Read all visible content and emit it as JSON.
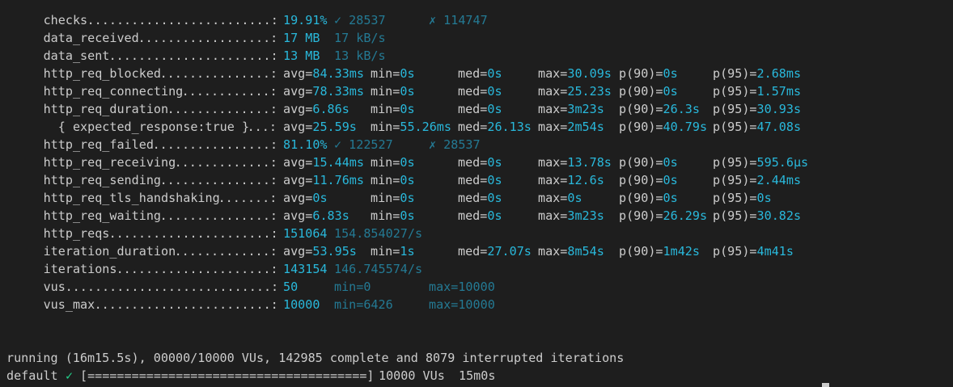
{
  "metrics": [
    {
      "name": "checks",
      "dots": ".........................:",
      "values": [
        {
          "text": "19.91%",
          "style": "hl"
        },
        {
          "text": "✓ 28537",
          "style": "dim"
        },
        {
          "text": "✗ 114747",
          "style": "dim"
        }
      ]
    },
    {
      "name": "data_received",
      "dots": "..................:",
      "values": [
        {
          "text": "17 MB",
          "style": "hl"
        },
        {
          "text": "17 kB/s",
          "style": "dim"
        }
      ]
    },
    {
      "name": "data_sent",
      "dots": "......................:",
      "values": [
        {
          "text": "13 MB",
          "style": "hl"
        },
        {
          "text": "13 kB/s",
          "style": "dim"
        }
      ]
    },
    {
      "name": "http_req_blocked",
      "dots": "...............:",
      "stats": {
        "avg": "84.33ms",
        "min": "0s",
        "med": "0s",
        "max": "30.09s",
        "p90": "0s",
        "p95": "2.68ms"
      }
    },
    {
      "name": "http_req_connecting",
      "dots": "............:",
      "stats": {
        "avg": "78.33ms",
        "min": "0s",
        "med": "0s",
        "max": "25.23s",
        "p90": "0s",
        "p95": "1.57ms"
      }
    },
    {
      "name": "http_req_duration",
      "dots": "..............:",
      "stats": {
        "avg": "6.86s",
        "min": "0s",
        "med": "0s",
        "max": "3m23s",
        "p90": "26.3s",
        "p95": "30.93s"
      }
    },
    {
      "name": "  { expected_response:true }",
      "dots": "...:",
      "stats": {
        "avg": "25.59s",
        "min": "55.26ms",
        "med": "26.13s",
        "max": "2m54s",
        "p90": "40.79s",
        "p95": "47.08s"
      }
    },
    {
      "name": "http_req_failed",
      "dots": "................:",
      "values": [
        {
          "text": "81.10%",
          "style": "hl"
        },
        {
          "text": "✓ 122527",
          "style": "dim"
        },
        {
          "text": "✗ 28537",
          "style": "dim"
        }
      ]
    },
    {
      "name": "http_req_receiving",
      "dots": ".............:",
      "stats": {
        "avg": "15.44ms",
        "min": "0s",
        "med": "0s",
        "max": "13.78s",
        "p90": "0s",
        "p95": "595.6µs"
      }
    },
    {
      "name": "http_req_sending",
      "dots": "...............:",
      "stats": {
        "avg": "11.76ms",
        "min": "0s",
        "med": "0s",
        "max": "12.6s",
        "p90": "0s",
        "p95": "2.44ms"
      }
    },
    {
      "name": "http_req_tls_handshaking",
      "dots": ".......:",
      "stats": {
        "avg": "0s",
        "min": "0s",
        "med": "0s",
        "max": "0s",
        "p90": "0s",
        "p95": "0s"
      }
    },
    {
      "name": "http_req_waiting",
      "dots": "...............:",
      "stats": {
        "avg": "6.83s",
        "min": "0s",
        "med": "0s",
        "max": "3m23s",
        "p90": "26.29s",
        "p95": "30.82s"
      }
    },
    {
      "name": "http_reqs",
      "dots": "......................:",
      "values": [
        {
          "text": "151064",
          "style": "hl"
        },
        {
          "text": "154.854027/s",
          "style": "dim"
        }
      ]
    },
    {
      "name": "iteration_duration",
      "dots": ".............:",
      "stats": {
        "avg": "53.95s",
        "min": "1s",
        "med": "27.07s",
        "max": "8m54s",
        "p90": "1m42s",
        "p95": "4m41s"
      }
    },
    {
      "name": "iterations",
      "dots": ".....................:",
      "values": [
        {
          "text": "143154",
          "style": "hl"
        },
        {
          "text": "146.745574/s",
          "style": "dim"
        }
      ]
    },
    {
      "name": "vus",
      "dots": "............................:",
      "values": [
        {
          "text": "50",
          "style": "hl"
        },
        {
          "text": "min=0",
          "style": "dim"
        },
        {
          "text": "max=10000",
          "style": "dim"
        }
      ]
    },
    {
      "name": "vus_max",
      "dots": "........................:",
      "values": [
        {
          "text": "10000",
          "style": "hl"
        },
        {
          "text": "min=6426",
          "style": "dim"
        },
        {
          "text": "max=10000",
          "style": "dim"
        }
      ]
    }
  ],
  "stat_labels": {
    "avg": "avg=",
    "min": "min=",
    "med": "med=",
    "max": "max=",
    "p90": "p(90)=",
    "p95": "p(95)="
  },
  "footer": {
    "running": "running (16m15.5s), 00000/10000 VUs, 142985 complete and 8079 interrupted iterations",
    "default_label": "default",
    "check_mark": "✓",
    "progress_bar": "[======================================]",
    "progress_fraction": 1.0,
    "vus_text": "10000 VUs",
    "duration_text": "15m0s"
  },
  "colors": {
    "background": "#1e1e1e",
    "text": "#cccccc",
    "highlight": "#29b8db",
    "dim": "#247a94",
    "success": "#23d18b"
  }
}
